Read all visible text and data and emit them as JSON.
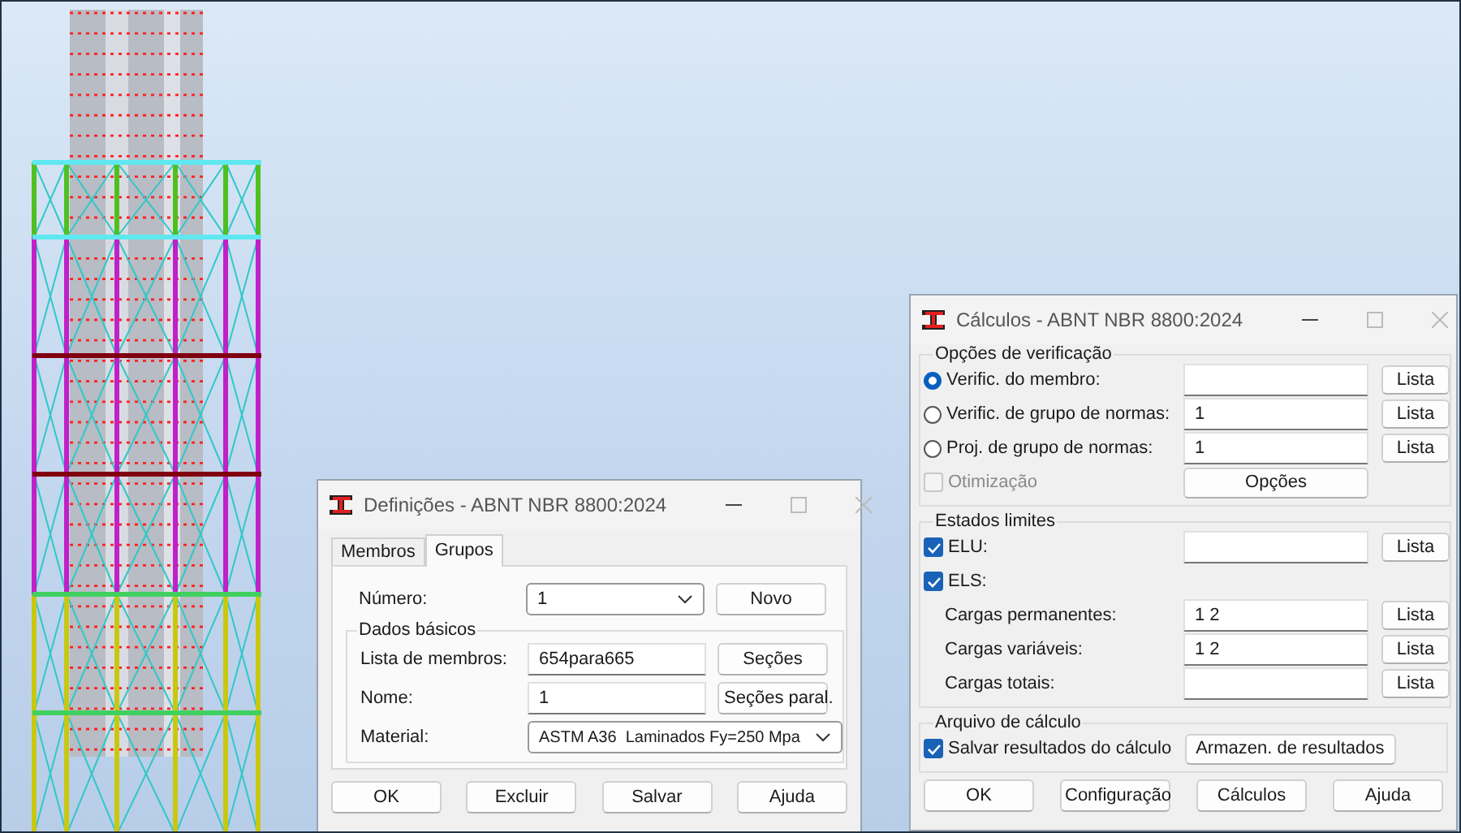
{
  "viewport": {
    "kind": "structure-model"
  },
  "definitions_dialog": {
    "title": "Definições - ABNT NBR 8800:2024",
    "tabs": [
      {
        "label": "Membros",
        "selected": false
      },
      {
        "label": "Grupos",
        "selected": true
      }
    ],
    "number_row": {
      "label": "Número:",
      "value": "1",
      "button": "Novo"
    },
    "group": {
      "title": "Dados básicos",
      "rows": [
        {
          "kind": "input",
          "label": "Lista de membros:",
          "value": "654para665",
          "button": "Seções"
        },
        {
          "kind": "input",
          "label": "Nome:",
          "value": "1",
          "button": "Seções paral."
        },
        {
          "kind": "select",
          "label": "Material:",
          "value": "ASTM A36  Laminados Fy=250 Mpa"
        }
      ]
    },
    "buttons": [
      "OK",
      "Excluir",
      "Salvar",
      "Ajuda"
    ]
  },
  "calculations_dialog": {
    "title": "Cálculos - ABNT NBR 8800:2024",
    "groups": [
      {
        "title": "Opções de verificação",
        "rows": [
          {
            "kind": "radio",
            "label": "Verific. do membro:",
            "selected": true,
            "field": true,
            "button": "Lista"
          },
          {
            "kind": "radio",
            "label": "Verific. de grupo de normas:",
            "selected": false,
            "field": true,
            "value": "1",
            "button": "Lista"
          },
          {
            "kind": "radio",
            "label": "Proj. de grupo de normas:",
            "selected": false,
            "field": true,
            "value": "1",
            "button": "Lista"
          },
          {
            "kind": "checkbox",
            "label": "Otimização",
            "checked": false,
            "disabled": true,
            "field": false,
            "button": "Opções"
          }
        ]
      },
      {
        "title": "Estados limites",
        "rows": [
          {
            "kind": "checkbox",
            "label": "ELU:",
            "checked": true,
            "disabled": false,
            "field": true,
            "button": "Lista"
          },
          {
            "kind": "checkbox",
            "label": "ELS:",
            "checked": true,
            "disabled": false,
            "field": false
          },
          {
            "kind": "text",
            "label": "Cargas permanentes:",
            "field": true,
            "value": "1 2",
            "button": "Lista"
          },
          {
            "kind": "text",
            "label": "Cargas variáveis:",
            "field": true,
            "value": "1 2",
            "button": "Lista"
          },
          {
            "kind": "text",
            "label": "Cargas totais:",
            "field": true,
            "button": "Lista"
          }
        ]
      },
      {
        "title": "Arquivo de cálculo",
        "rows": [
          {
            "kind": "checkbox",
            "label": "Salvar resultados do cálculo",
            "checked": true,
            "disabled": false,
            "field": false,
            "button": "Armazen. de resultados"
          }
        ]
      }
    ],
    "buttons": [
      "OK",
      "Configuração",
      "Cálculos",
      "Ajuda"
    ]
  }
}
